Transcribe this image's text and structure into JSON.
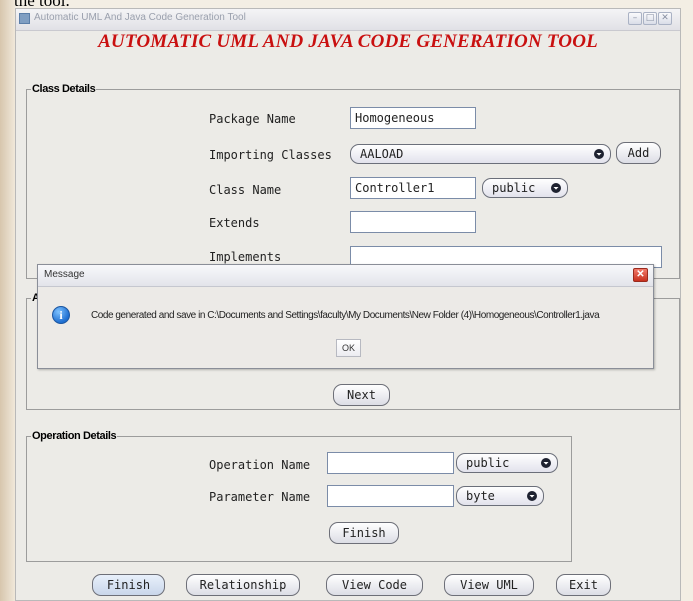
{
  "background": {
    "caption_fragment": "the tool."
  },
  "window": {
    "title": "Automatic UML And Java Code Generation Tool",
    "heading": "AUTOMATIC UML AND JAVA CODE GENERATION TOOL",
    "accent_color": "#c91010"
  },
  "class_details": {
    "legend": "Class Details",
    "package_name": {
      "label": "Package Name",
      "value": "Homogeneous"
    },
    "importing_classes": {
      "label": "Importing Classes",
      "selected": "AALOAD",
      "add_label": "Add"
    },
    "class_name": {
      "label": "Class Name",
      "value": "Controller1",
      "modifier": "public"
    },
    "extends": {
      "label": "Extends",
      "value": ""
    },
    "implements": {
      "label": "Implements",
      "value": ""
    }
  },
  "attribute_details": {
    "legend_partial": "At",
    "next_label": "Next"
  },
  "operation_details": {
    "legend": "Operation Details",
    "operation_name": {
      "label": "Operation Name",
      "value": "",
      "modifier": "public"
    },
    "parameter_name": {
      "label": "Parameter Name",
      "value": "",
      "type": "byte"
    },
    "finish_label": "Finish"
  },
  "bottom_bar": {
    "finish": "Finish",
    "relationship": "Relationship",
    "view_code": "View Code",
    "view_uml": "View UML",
    "exit": "Exit"
  },
  "dialog": {
    "title": "Message",
    "icon": "info-icon",
    "message": "Code generated and save in C:\\Documents and Settings\\faculty\\My Documents\\New Folder (4)\\Homogeneous\\Controller1.java",
    "ok_label": "OK"
  }
}
